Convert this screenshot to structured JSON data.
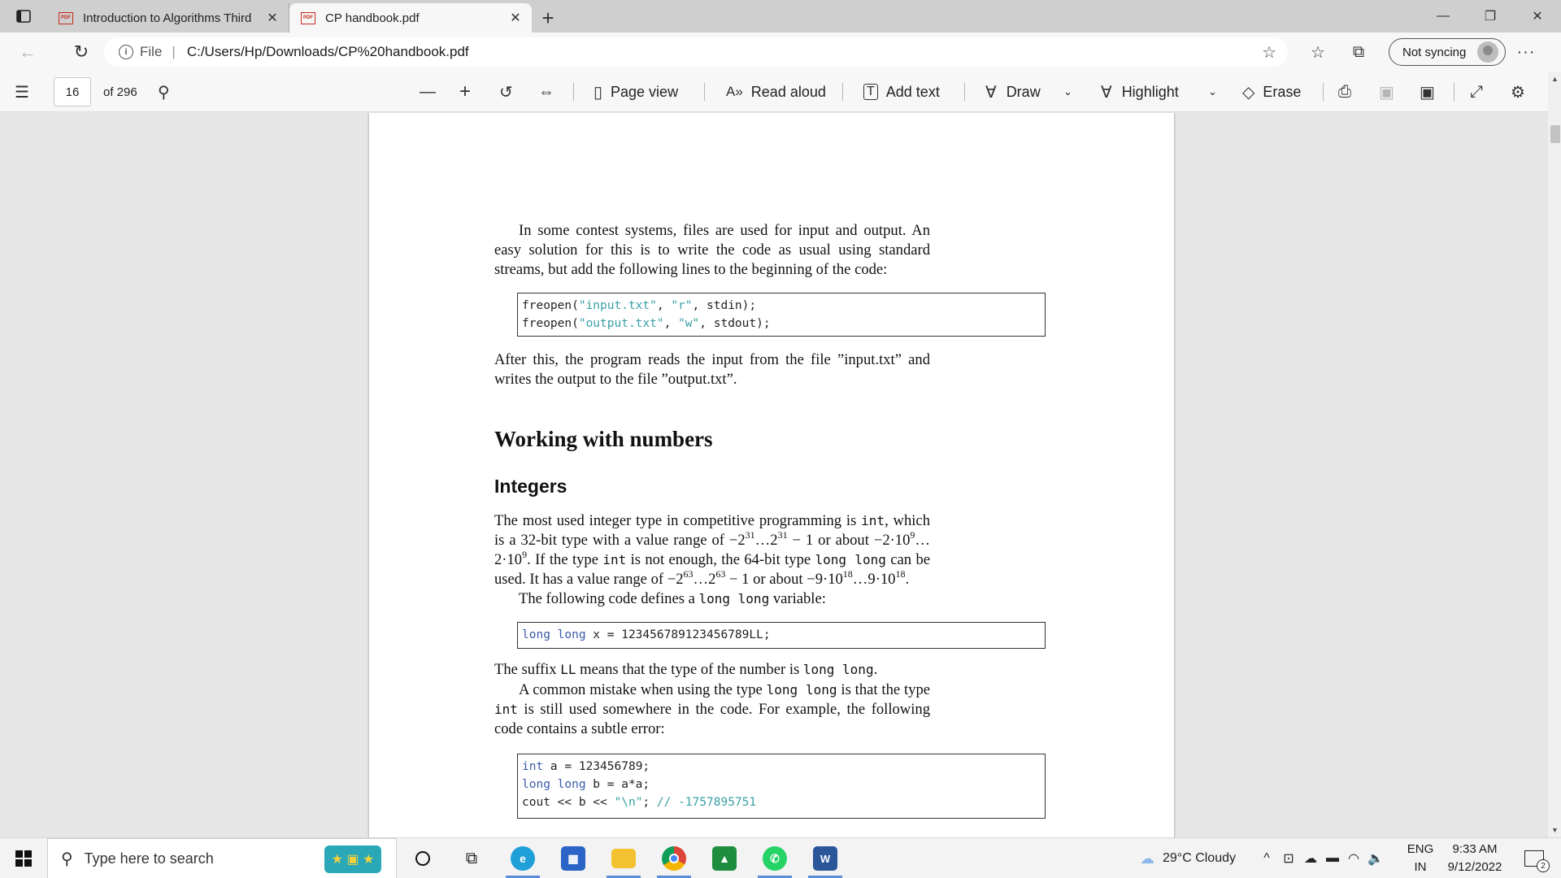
{
  "tabs": [
    {
      "title": "Introduction to Algorithms Third",
      "active": false
    },
    {
      "title": "CP handbook.pdf",
      "active": true
    }
  ],
  "address": {
    "file_label": "File",
    "url": "C:/Users/Hp/Downloads/CP%20handbook.pdf",
    "sync_label": "Not syncing"
  },
  "pdf_toolbar": {
    "page_number": "16",
    "page_total": "of 296",
    "page_view": "Page view",
    "read_aloud": "Read aloud",
    "add_text": "Add text",
    "draw": "Draw",
    "highlight": "Highlight",
    "erase": "Erase"
  },
  "document": {
    "para1": "In some contest systems, files are used for input and output. An easy solution for this is to write the code as usual using standard streams, but add the following lines to the beginning of the code:",
    "code1": [
      {
        "pre": "freopen(",
        "s1": "\"input.txt\"",
        "mid": ", ",
        "s2": "\"r\"",
        "post": ", stdin);"
      },
      {
        "pre": "freopen(",
        "s1": "\"output.txt\"",
        "mid": ", ",
        "s2": "\"w\"",
        "post": ", stdout);"
      }
    ],
    "para2": "After this, the program reads the input from the file ”input.txt” and writes the output to the file ”output.txt”.",
    "heading1": "Working with numbers",
    "heading2": "Integers",
    "para3": {
      "t1": "The most used integer type in competitive programming is ",
      "int1": "int",
      "t2": ", which is a 32-bit type with a value range of −2",
      "e31a": "31",
      "t3": "…2",
      "e31b": "31",
      "t4": " − 1 or about −2·10",
      "e9a": "9",
      "t5": "…2·10",
      "e9b": "9",
      "t6": ". If the type ",
      "int2": "int",
      "t7": " is not enough, the 64-bit type ",
      "ll1": "long long",
      "t8": " can be used. It has a value range of −2",
      "e63a": "63",
      "t9": "…2",
      "e63b": "63",
      "t10": " − 1 or about −9·10",
      "e18a": "18",
      "t11": "…9·10",
      "e18b": "18",
      "t12": "."
    },
    "para4": {
      "t1": "The following code defines a ",
      "ll": "long long",
      "t2": " variable:"
    },
    "code2": {
      "kw": "long long",
      "rest": " x = 123456789123456789LL;"
    },
    "para5": {
      "t1": "The suffix ",
      "ll": "LL",
      "t2": " means that the type of the number is ",
      "ll2": "long long",
      "t3": "."
    },
    "para6": {
      "t1": "A common mistake when using the type ",
      "ll": "long long",
      "t2": " is that the type ",
      "int": "int",
      "t3": " is still used somewhere in the code. For example, the following code contains a subtle error:"
    },
    "code3": [
      {
        "kw": "int",
        "rest": " a = 123456789;"
      },
      {
        "kw": "long long",
        "rest": " b = a*a;"
      },
      {
        "pre": "cout << b << ",
        "str": "\"\\n\"",
        "mid": "; ",
        "cm": "// -1757895751"
      }
    ]
  },
  "taskbar": {
    "search_placeholder": "Type here to search",
    "weather": "29°C  Cloudy",
    "lang_top": "ENG",
    "lang_bottom": "IN",
    "time": "9:33 AM",
    "date": "9/12/2022",
    "notifications": "2"
  },
  "colors": {
    "code_string": "#3aa0a6",
    "code_keyword": "#3a5aa8",
    "pdf_red": "#c42b1c"
  }
}
